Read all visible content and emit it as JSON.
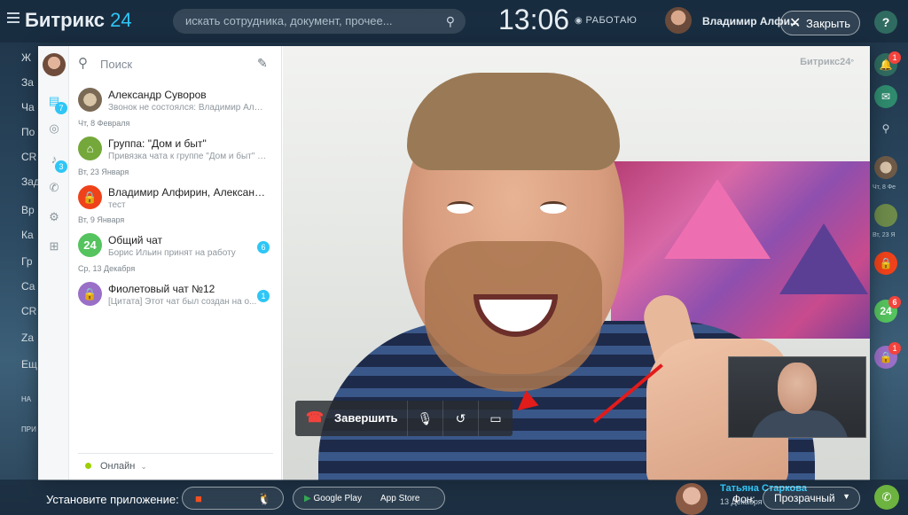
{
  "topbar": {
    "logo_main": "Битрикс",
    "logo_num": "24",
    "search_placeholder": "искать сотрудника, документ, прочее...",
    "clock": "13:06",
    "work_status": "РАБОТАЮ",
    "user_name": "Владимир Алфи...",
    "close_label": "Закрыть",
    "help_label": "?"
  },
  "leftnav": [
    "Ж",
    "За",
    "Ча",
    "По",
    "CR",
    "Зад",
    "Вр",
    "Ка",
    "Гр",
    "Са",
    "CR",
    "Za",
    "Ещ",
    "НА",
    "ПРИ"
  ],
  "messenger": {
    "search_label": "Поиск",
    "side_badges": {
      "chats": "7",
      "notifications": "3"
    },
    "chats": [
      {
        "title": "Александр Суворов",
        "subtitle": "Звонок не состоялся: Владимир Алф...",
        "badge": ""
      },
      {
        "date": "Чт, 8 Февраля"
      },
      {
        "title": "Группа: \"Дом и быт\"",
        "subtitle": "Привязка чата к группе \"Дом и быт\" у...",
        "badge": ""
      },
      {
        "date": "Вт, 23 Января"
      },
      {
        "title": "Владимир Алфирин, Александр Тр...",
        "subtitle": "тест",
        "badge": ""
      },
      {
        "date": "Вт, 9 Января"
      },
      {
        "title": "Общий чат",
        "subtitle": "Борис Ильин принят на работу",
        "badge": "6",
        "avatar": "24"
      },
      {
        "date": "Ср, 13 Декабря"
      },
      {
        "title": "Фиолетовый чат №12",
        "subtitle": "[Цитата] Этот чат был создан на о...",
        "badge": "1"
      }
    ],
    "status": "Онлайн"
  },
  "video": {
    "watermark": "Битрикс24",
    "end_call_label": "Завершить"
  },
  "rightbar": {
    "dates": [
      "Чт, 8 Фе",
      "Вт, 23 Я"
    ],
    "badges": {
      "bell": "1",
      "chat24": "6",
      "lock": "1"
    },
    "chat24": "24"
  },
  "bottom": {
    "install_label": "Установите приложение:",
    "google_play": "Google Play",
    "app_store": "App Store",
    "user_name": "Татьяна Старкова",
    "user_date": "13 Декабря",
    "bg_label": "Фон:",
    "bg_value": "Прозрачный"
  },
  "colors": {
    "accent": "#2fc6f6",
    "end_call": "#f4433c",
    "arrow": "#e21b1b",
    "online": "#9dcf00"
  }
}
